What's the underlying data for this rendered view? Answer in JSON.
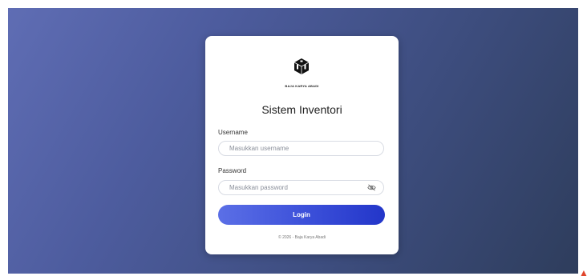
{
  "brand": {
    "name": "BAJA KARYA ABADI"
  },
  "login": {
    "title": "Sistem Inventori",
    "username_label": "Username",
    "username_placeholder": "Masukkan username",
    "password_label": "Password",
    "password_placeholder": "Masukkan password",
    "button_label": "Login",
    "footer": "© 2026 - Baja Karya Abadi"
  },
  "colors": {
    "background_start": "#5f6db4",
    "background_end": "#2e3d5c",
    "button_start": "#5b6fe6",
    "button_end": "#2336c9"
  },
  "icons": {
    "logo": "cube-logo-icon",
    "toggle": "eye-off-icon"
  }
}
